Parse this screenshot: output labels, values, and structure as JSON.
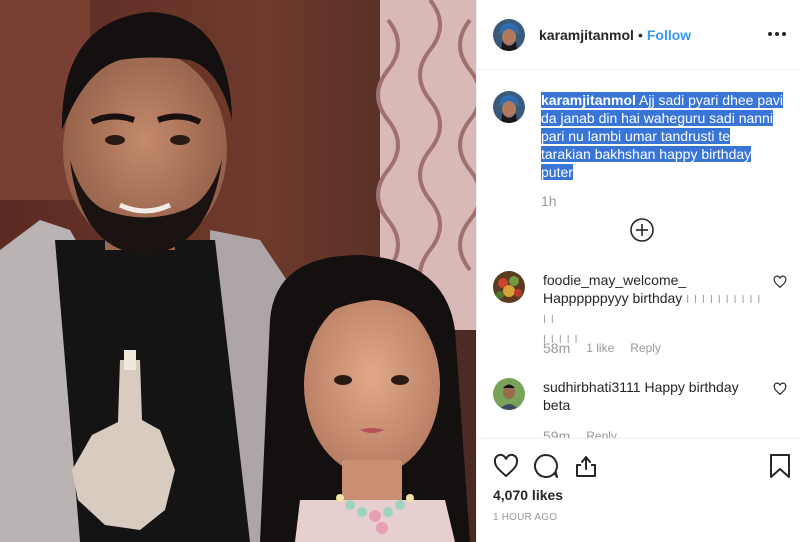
{
  "post": {
    "author": {
      "username": "karamjitanmol",
      "separator": "•",
      "follow_label": "Follow"
    },
    "caption": {
      "username": "karamjitanmol",
      "lines": [
        " Ajj sadi pyari dhee pavi",
        "da janab din hai waheguru sadi nanni",
        "pari nu lambi umar tandrusti te",
        "tarakian bakhshan happy birthday",
        "puter"
      ],
      "time": "1h"
    },
    "comments": [
      {
        "username": "foodie_may_welcome_",
        "text": "Happppppyyy birthday",
        "glyphs_line1": "ǀ ǀ ǀ ǀ ǀ ǀ ǀ ǀ ǀ ǀ ǀ ǀ",
        "glyphs_line2": "ǀ ǀ ǀ ǀ ǀ",
        "time": "58m",
        "likes": "1 like",
        "reply": "Reply"
      },
      {
        "username": "sudhirbhati3111",
        "text_line1": "Happy birthday",
        "text_line2": "beta",
        "time": "59m",
        "reply": "Reply"
      }
    ],
    "likes": "4,070 likes",
    "timestamp": "1 HOUR AGO"
  },
  "icons": {
    "more": "more-options-icon",
    "load_more": "plus-circle-icon",
    "like": "heart-icon",
    "comment": "comment-bubble-icon",
    "share": "share-icon",
    "save": "bookmark-icon"
  },
  "colors": {
    "accent": "#3897f0",
    "selection": "#3875d7",
    "muted": "#999999",
    "text": "#262626"
  }
}
